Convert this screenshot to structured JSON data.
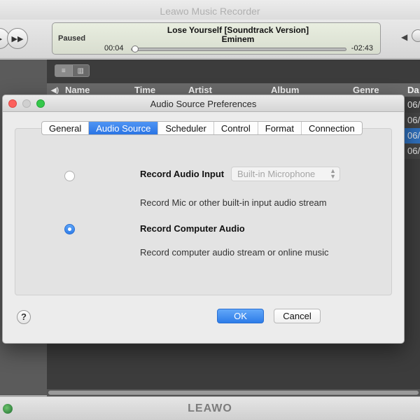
{
  "app": {
    "title": "Leawo Music Recorder",
    "brand": "LEAWO",
    "player": {
      "status": "Paused",
      "song": "Lose Yourself [Soundtrack Version]",
      "artist": "Eminem",
      "elapsed": "00:04",
      "remaining": "-02:43",
      "progress_fraction": 0.02
    },
    "columns": [
      "Name",
      "Time",
      "Artist",
      "Album",
      "Genre",
      "Da"
    ],
    "rows": [
      {
        "date": "06/",
        "selected": false
      },
      {
        "date": "06/",
        "selected": false
      },
      {
        "date": "06/",
        "selected": true
      },
      {
        "date": "06/",
        "selected": false
      }
    ]
  },
  "dialog": {
    "title": "Audio Source Preferences",
    "tabs": [
      {
        "label": "General",
        "active": false
      },
      {
        "label": "Audio Source",
        "active": true
      },
      {
        "label": "Scheduler",
        "active": false
      },
      {
        "label": "Control",
        "active": false
      },
      {
        "label": "Format",
        "active": false
      },
      {
        "label": "Connection",
        "active": false
      }
    ],
    "option_input": {
      "label": "Record Audio Input",
      "selected": false,
      "select_value": "Built-in Microphone",
      "description": "Record Mic or other built-in input audio stream"
    },
    "option_computer": {
      "label": "Record Computer Audio",
      "selected": true,
      "description": "Record computer audio stream or online music"
    },
    "help_label": "?",
    "ok_label": "OK",
    "cancel_label": "Cancel"
  },
  "colors": {
    "accent": "#2d7ce8",
    "selected_row": "#2f6fbb",
    "close": "#fc605c",
    "zoom": "#34c84a"
  }
}
